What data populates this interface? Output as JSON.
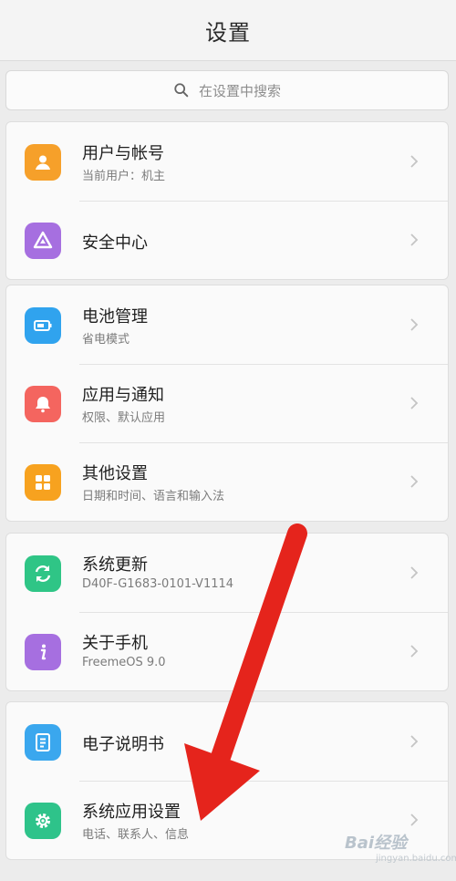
{
  "header": {
    "title": "设置"
  },
  "search": {
    "placeholder": "在设置中搜索"
  },
  "cards": [
    {
      "items": [
        {
          "label": "用户与帐号",
          "sub": "当前用户：机主",
          "icon": "user-icon",
          "color": "#f6a02a"
        },
        {
          "label": "安全中心",
          "sub": "",
          "icon": "shield-icon",
          "color": "#a66fe0"
        }
      ]
    },
    {
      "items": [
        {
          "label": "电池管理",
          "sub": "省电模式",
          "icon": "battery-icon",
          "color": "#30a3ee"
        },
        {
          "label": "应用与通知",
          "sub": "权限、默认应用",
          "icon": "bell-icon",
          "color": "#f4655f"
        },
        {
          "label": "其他设置",
          "sub": "日期和时间、语言和输入法",
          "icon": "grid-icon",
          "color": "#f7a21f"
        }
      ]
    },
    {
      "items": [
        {
          "label": "系统更新",
          "sub": "D40F-G1683-0101-V1114",
          "icon": "refresh-icon",
          "color": "#2fc586"
        },
        {
          "label": "关于手机",
          "sub": "FreemeOS 9.0",
          "icon": "info-icon",
          "color": "#a66fe0"
        }
      ]
    },
    {
      "items": [
        {
          "label": "电子说明书",
          "sub": "",
          "icon": "manual-icon",
          "color": "#3aa7ee"
        },
        {
          "label": "系统应用设置",
          "sub": "电话、联系人、信息",
          "icon": "gear-icon",
          "color": "#2ec38a"
        }
      ]
    }
  ],
  "watermark": {
    "text": "Bai经验",
    "sub": "jingyan.baidu.com"
  },
  "colors": {
    "annotation_arrow": "#e5241c",
    "chevron": "#c4c4c4"
  }
}
